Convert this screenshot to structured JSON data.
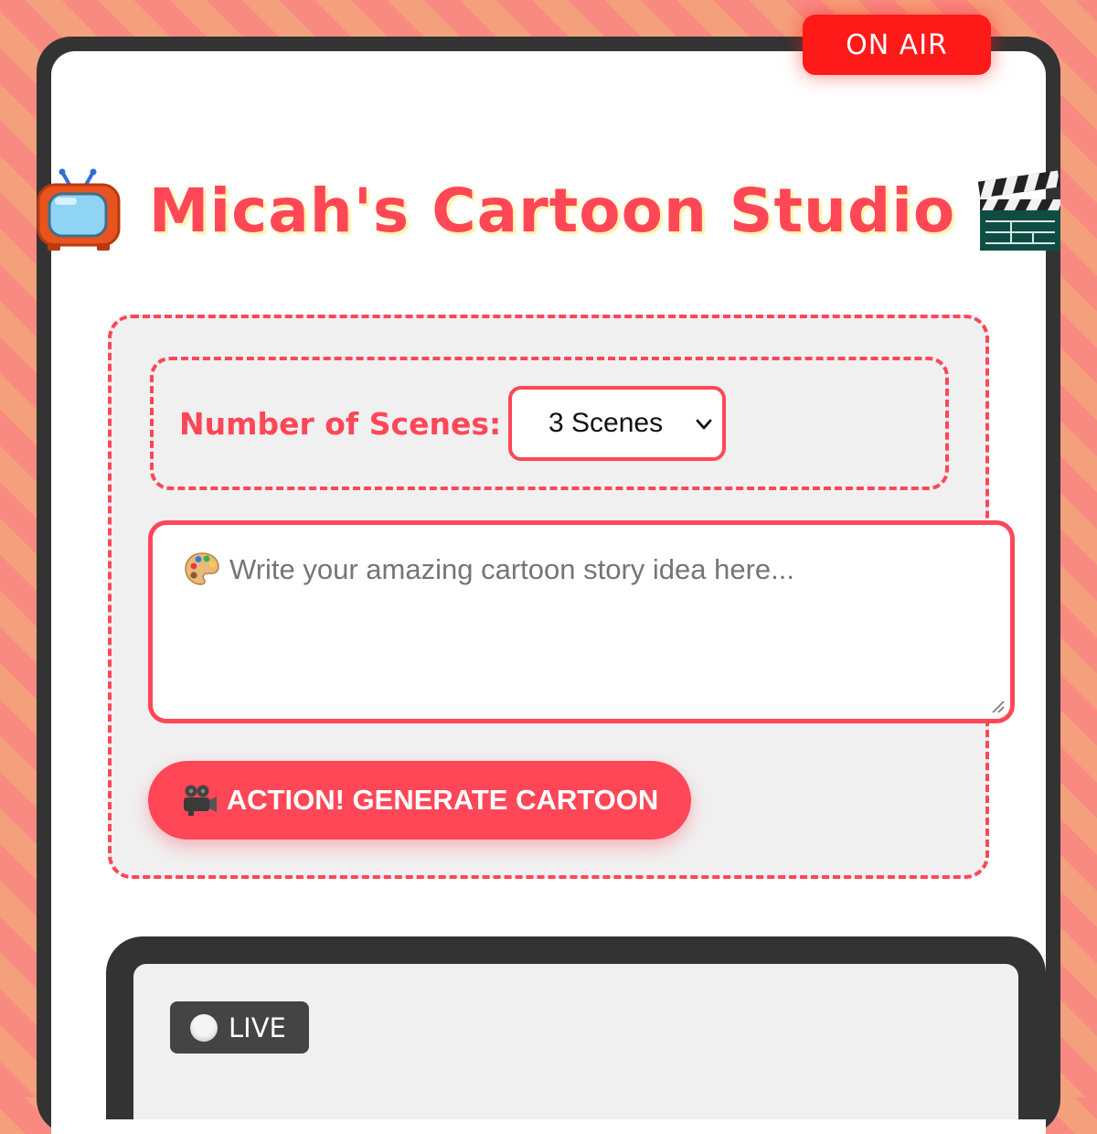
{
  "header": {
    "on_air_label": "ON AIR",
    "title": "Micah's Cartoon Studio",
    "left_icon": "tv-icon",
    "right_icon": "clapper-board-icon"
  },
  "form": {
    "scenes_label": "Number of Scenes:",
    "scenes_selected": "3 Scenes",
    "story_placeholder": "Write your amazing cartoon story idea here...",
    "story_icon": "palette-icon",
    "generate_label": "ACTION! GENERATE CARTOON",
    "generate_icon": "movie-camera-icon"
  },
  "viewer": {
    "live_label": "LIVE"
  },
  "colors": {
    "accent": "#ff4757",
    "on_air": "#ff1a1a",
    "frame": "#333333",
    "card_bg": "#f0f0f0"
  }
}
